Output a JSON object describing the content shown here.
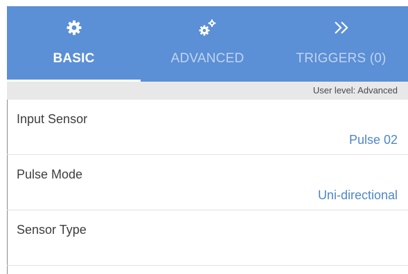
{
  "tabs": [
    {
      "label": "BASIC",
      "icon": "gear-icon",
      "active": true
    },
    {
      "label": "ADVANCED",
      "icon": "gears-icon",
      "active": false
    },
    {
      "label": "TRIGGERS (0)",
      "icon": "double-chevron-right-icon",
      "active": false
    }
  ],
  "user_level": "User level: Advanced",
  "settings": [
    {
      "title": "Input Sensor",
      "value": "Pulse 02"
    },
    {
      "title": "Pulse Mode",
      "value": "Uni-directional"
    },
    {
      "title": "Sensor Type",
      "value": ""
    }
  ],
  "colors": {
    "tab_bar": "#5b8fd6",
    "value_text": "#4f86c6",
    "user_bar": "#e8e8e8"
  }
}
